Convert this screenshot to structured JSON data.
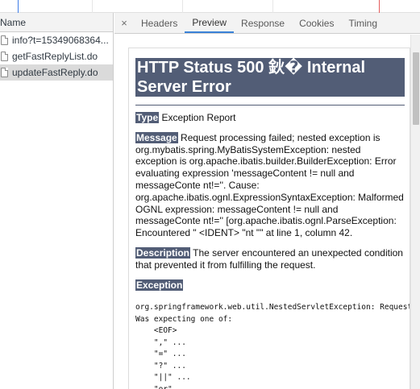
{
  "request_list": {
    "column_header": "Name",
    "items": [
      {
        "name": "info?t=15349068364..."
      },
      {
        "name": "getFastReplyList.do"
      },
      {
        "name": "updateFastReply.do"
      }
    ]
  },
  "tabs": {
    "close_glyph": "×",
    "items": [
      "Headers",
      "Preview",
      "Response",
      "Cookies",
      "Timing"
    ],
    "active": "Preview"
  },
  "preview": {
    "title": "HTTP Status 500 鈥� Internal Server Error",
    "type_label": "Type",
    "type_value": " Exception Report",
    "message_label": "Message",
    "message_value": " Request processing failed; nested exception is org.mybatis.spring.MyBatisSystemException: nested exception is org.apache.ibatis.builder.BuilderException: Error evaluating expression 'messageContent != null and messageConte nt!=''. Cause: org.apache.ibatis.ognl.ExpressionSyntaxException: Malformed OGNL expression: messageContent != null and messageConte nt!='' [org.apache.ibatis.ognl.ParseException: Encountered \" <IDENT> \"nt \"\" at line 1, column 42.",
    "description_label": "Description",
    "description_value": " The server encountered an unexpected condition that prevented it from fulfilling the request.",
    "exception_label": "Exception",
    "exception_text": "org.springframework.web.util.NestedServletException: Request processing failed\nWas expecting one of:\n    <EOF>\n    \",\" ...\n    \"=\" ...\n    \"?\" ...\n    \"||\" ...\n    \"or\" ...\n    \"&&\" ..."
  },
  "colors": {
    "accent_tab": "#3a82d8",
    "tomcat_header": "#525d76",
    "selected_row": "#dadada"
  }
}
